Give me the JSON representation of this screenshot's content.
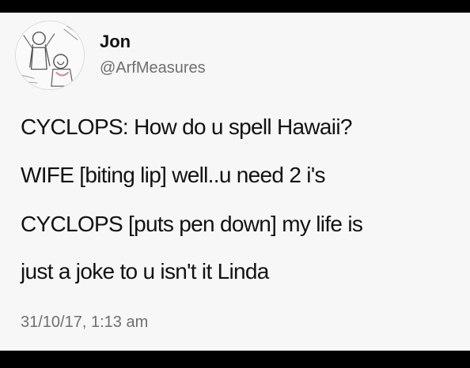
{
  "author": {
    "display_name": "Jon",
    "handle": "@ArfMeasures",
    "avatar_icon": "cartoon-drawing-avatar"
  },
  "tweet": {
    "lines": [
      "CYCLOPS: How do u spell Hawaii?",
      "WIFE [biting lip] well..u need 2 i's",
      "CYCLOPS [puts pen down] my life is",
      "just a joke to u isn't it Linda"
    ],
    "timestamp": "31/10/17, 1:13 am"
  },
  "colors": {
    "card_background": "#f7f7f7",
    "frame": "#000000",
    "text_primary": "#121212",
    "text_secondary": "#6f6f6f"
  }
}
